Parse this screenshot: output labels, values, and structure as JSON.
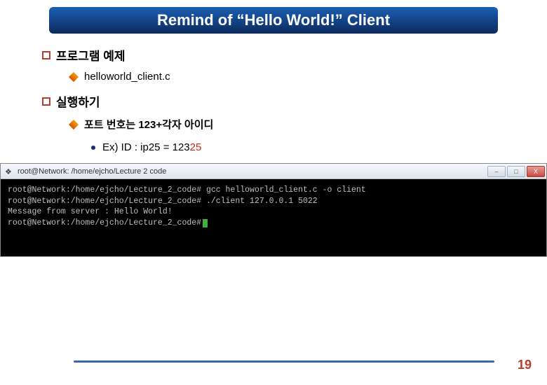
{
  "title": "Remind of “Hello World!” Client",
  "section1": {
    "heading": "프로그램 예제",
    "item": "helloworld_client.c"
  },
  "section2": {
    "heading": "실행하기",
    "item": "포트 번호는 123+각자 아이디",
    "subitem_prefix": "Ex) ID : ip25 = 123",
    "subitem_red": "25"
  },
  "terminal": {
    "window_title": "root@Network: /home/ejcho/Lecture 2 code",
    "lines": [
      "root@Network:/home/ejcho/Lecture_2_code# gcc helloworld_client.c -o client",
      "root@Network:/home/ejcho/Lecture_2_code# ./client 127.0.0.1 5022",
      "Message from server : Hello World!",
      "",
      "root@Network:/home/ejcho/Lecture_2_code#"
    ],
    "min_label": "–",
    "max_label": "□",
    "close_label": "X"
  },
  "page_number": "19"
}
